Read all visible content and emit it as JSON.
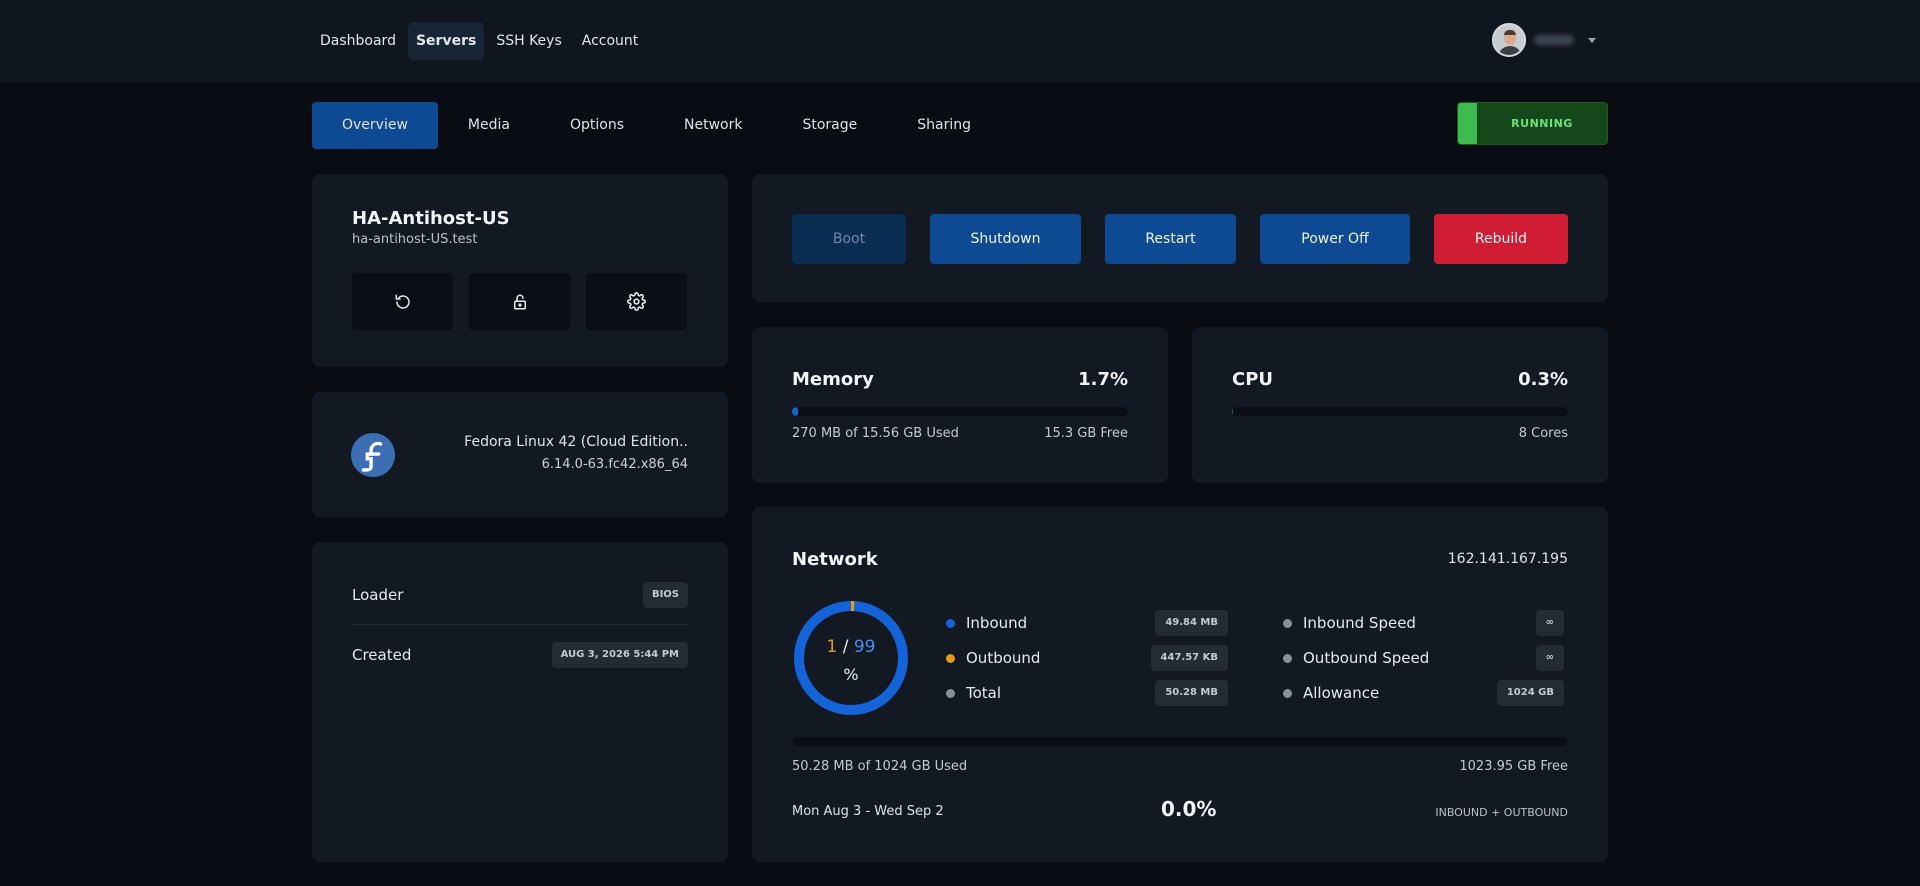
{
  "topnav": {
    "items": [
      {
        "label": "Dashboard",
        "active": false
      },
      {
        "label": "Servers",
        "active": true
      },
      {
        "label": "SSH Keys",
        "active": false
      },
      {
        "label": "Account",
        "active": false
      }
    ]
  },
  "tabs": [
    {
      "label": "Overview",
      "active": true
    },
    {
      "label": "Media",
      "active": false
    },
    {
      "label": "Options",
      "active": false
    },
    {
      "label": "Network",
      "active": false
    },
    {
      "label": "Storage",
      "active": false
    },
    {
      "label": "Sharing",
      "active": false
    }
  ],
  "status": {
    "label": "RUNNING",
    "color": "#3dbb4f"
  },
  "server": {
    "name": "HA-Antihost-US",
    "hostname": "ha-antihost-US.test",
    "action_icons": [
      "refresh-icon",
      "lock-icon",
      "gear-icon"
    ]
  },
  "os": {
    "logo": "fedora-logo",
    "name": "Fedora Linux 42 (Cloud Edition..",
    "kernel": "6.14.0-63.fc42.x86_64"
  },
  "info": {
    "loader_label": "Loader",
    "loader_value": "BIOS",
    "created_label": "Created",
    "created_value": "AUG 3, 2026 5:44 PM"
  },
  "power": {
    "boot": "Boot",
    "shutdown": "Shutdown",
    "restart": "Restart",
    "power_off": "Power Off",
    "rebuild": "Rebuild"
  },
  "memory": {
    "title": "Memory",
    "percent": "1.7%",
    "fill_fraction": 0.017,
    "used": "270 MB of 15.56 GB Used",
    "free": "15.3 GB Free"
  },
  "cpu": {
    "title": "CPU",
    "percent": "0.3%",
    "fill_fraction": 0.003,
    "cores": "8 Cores"
  },
  "network": {
    "title": "Network",
    "ip": "162.141.167.195",
    "donut": {
      "used": "1",
      "separator": "/",
      "total": "99",
      "unit": "%",
      "used_fraction": 0.01,
      "used_color": "#e39a1c",
      "rest_color": "#1463d9"
    },
    "legend_left": [
      {
        "label": "Inbound",
        "value": "49.84 MB",
        "color": "#1463d9"
      },
      {
        "label": "Outbound",
        "value": "447.57 KB",
        "color": "#e39a1c"
      },
      {
        "label": "Total",
        "value": "50.28 MB",
        "color": "#8a9099"
      }
    ],
    "legend_right": [
      {
        "label": "Inbound Speed",
        "value": "∞",
        "color": "#8a9099"
      },
      {
        "label": "Outbound Speed",
        "value": "∞",
        "color": "#8a9099"
      },
      {
        "label": "Allowance",
        "value": "1024 GB",
        "color": "#8a9099"
      }
    ],
    "used": "50.28 MB of 1024 GB Used",
    "free": "1023.95 GB Free",
    "period": "Mon Aug 3 - Wed Sep 2",
    "percent": "0.0%",
    "note": "INBOUND + OUTBOUND"
  }
}
